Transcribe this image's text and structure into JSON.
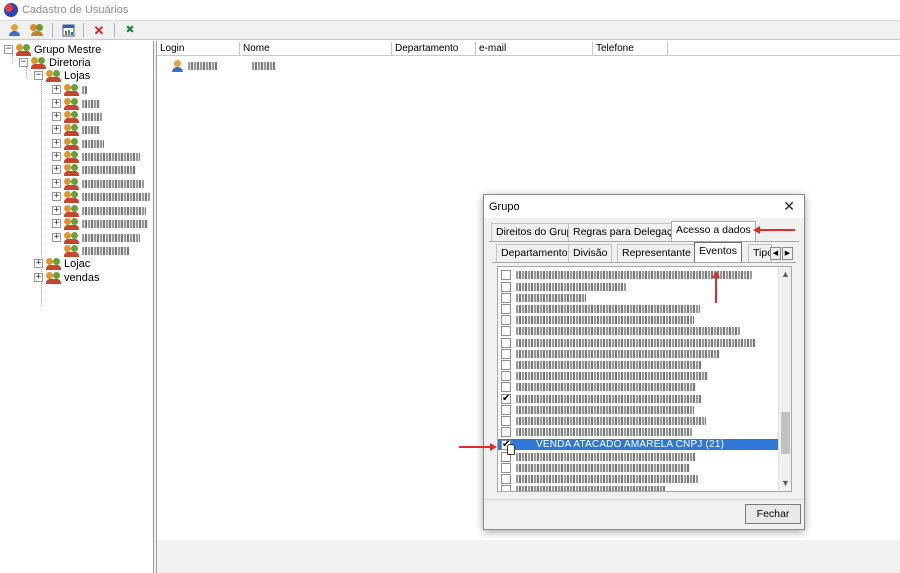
{
  "window": {
    "title": "Cadastro de Usuários"
  },
  "toolbar": {
    "buttons": [
      {
        "icon": "add-user-icon"
      },
      {
        "icon": "add-group-icon"
      },
      {
        "icon": "properties-icon"
      },
      {
        "icon": "delete-icon",
        "glyph": "✕"
      },
      {
        "icon": "excel-export-icon",
        "glyph": "✖"
      }
    ]
  },
  "tree": {
    "root": "Grupo Mestre",
    "diretoria": "Diretoria",
    "lojas": "Lojas",
    "lojac": "Lojac",
    "vendas": "vendas",
    "expand_glyph": "+",
    "collapse_glyph": "−"
  },
  "grid": {
    "columns": [
      "Login",
      "Nome",
      "Departamento",
      "e-mail",
      "Telefone"
    ]
  },
  "dialog": {
    "title": "Grupo",
    "close_glyph": "✕",
    "tabs_top": [
      "Direitos do Grupo",
      "Regras para Delegação",
      "Acesso a dados"
    ],
    "tabs_sub": [
      "Departamento",
      "Divisão",
      "Representante",
      "Eventos",
      "Tipo"
    ],
    "tab_scroll_left": "◀",
    "tab_scroll_right": "▶",
    "selected_item": "VENDA ATACADO AMARELA CNPJ (21)",
    "checkmark": "✔",
    "scroll_up": "▲",
    "scroll_down": "▼",
    "close_button": "Fechar"
  },
  "colors": {
    "selection": "#3078d7",
    "annotation_arrow": "#e42b2b"
  }
}
